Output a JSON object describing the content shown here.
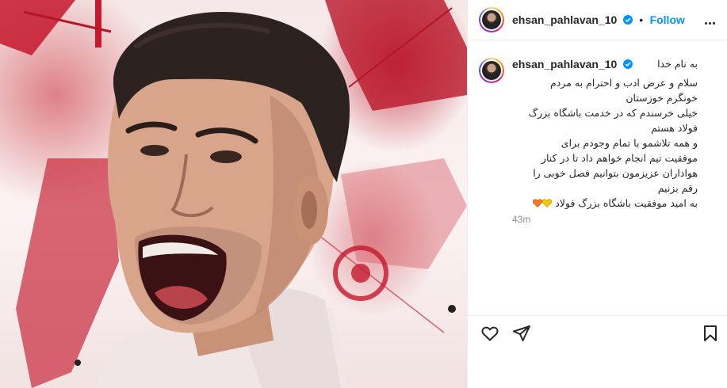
{
  "post": {
    "username": "ehsan_pahlavan_10",
    "follow_label": "Follow",
    "header_separator": "•",
    "caption_first_line": "به نام خدا",
    "caption_lines": [
      "سلام و عرض ادب و احترام به مردم",
      "خونگرم خوزستان",
      "خیلی خرسندم که در خدمت باشگاه بزرگ",
      "فولاد هستم",
      "و همه تلاشمو با تمام وجودم برای",
      "موفقیت تیم انجام خواهم داد تا در کنار",
      "هواداران عزیزمون بتوانیم فصل خوبی را",
      "رقم بزنیم"
    ],
    "caption_last_line": "به امید موفقیت باشگاه بزرگ فولاد",
    "timestamp": "43m"
  },
  "icons": {
    "verified": "verified-badge-icon",
    "more": "more-options-icon",
    "like": "heart-icon",
    "share": "paper-plane-icon",
    "save": "bookmark-icon",
    "hearts": [
      "orange-heart-icon",
      "yellow-heart-icon"
    ]
  },
  "colors": {
    "accent": "#0095f6",
    "text": "#262626",
    "muted": "#8e8e8e",
    "divider": "#efefef",
    "image_red": "#c8283a"
  }
}
